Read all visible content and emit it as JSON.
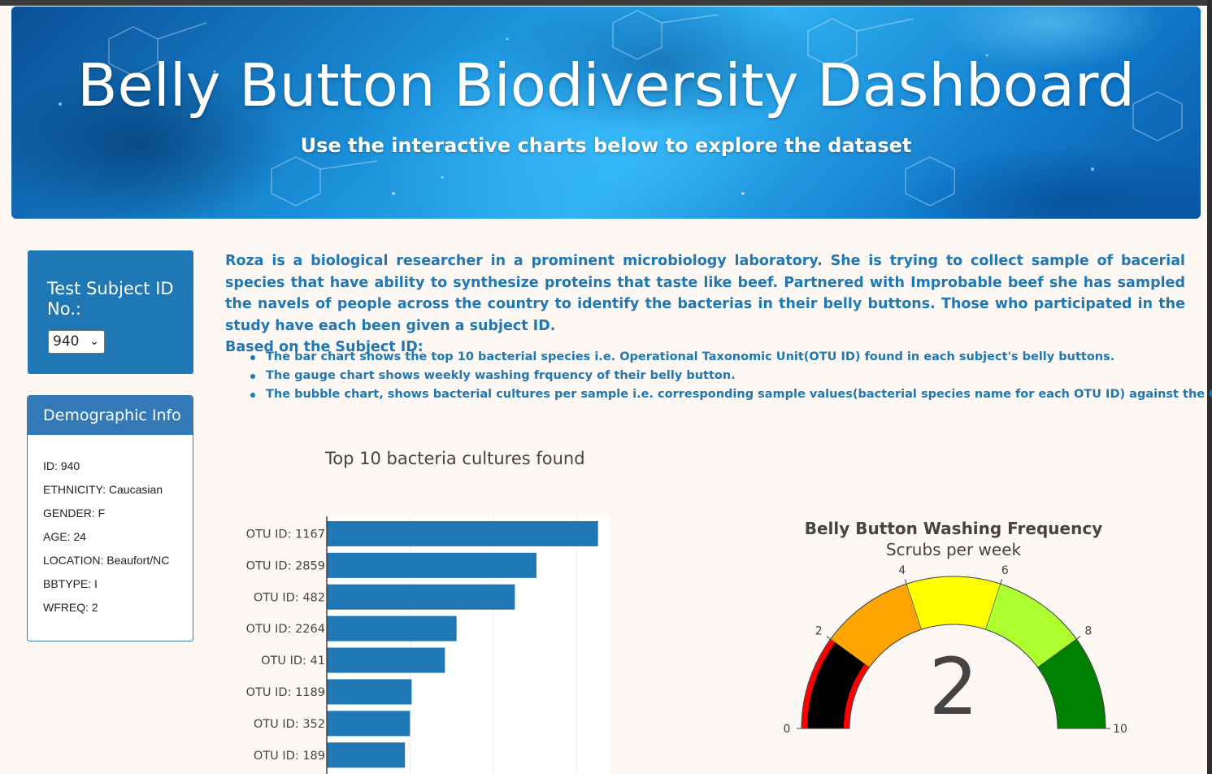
{
  "header": {
    "title": "Belly Button Biodiversity Dashboard",
    "subtitle": "Use the interactive charts below to explore the dataset"
  },
  "selector": {
    "label": "Test Subject ID No.:",
    "value": "940"
  },
  "demographics": {
    "heading": "Demographic Info",
    "rows": [
      "ID: 940",
      "ETHNICITY: Caucasian",
      "GENDER: F",
      "AGE: 24",
      "LOCATION: Beaufort/NC",
      "BBTYPE: I",
      "WFREQ: 2"
    ]
  },
  "intro": {
    "paragraph": "Roza is a biological researcher in a prominent microbiology laboratory. She is trying to collect sample of bacerial species that have ability to synthesize proteins that taste like beef. Partnered with Improbable beef she has sampled the navels of people across the country to identify the bacterias in their belly buttons. Those who participated in the study have each been given a subject ID.",
    "lead": "Based on the Subject ID:",
    "bullets": [
      "The bar chart shows the top 10 bacterial species i.e. Operational Taxonomic Unit(OTU ID) found in each subject's belly buttons.",
      "The gauge chart shows weekly washing frquency of their belly button.",
      "The bubble chart, shows bacterial cultures per sample i.e. corresponding sample values(bacterial species name for each OTU ID) against the OTU ID."
    ]
  },
  "chart_data": [
    {
      "type": "bar",
      "orientation": "horizontal",
      "title": "Top 10 bacteria cultures found",
      "categories": [
        "OTU ID: 1167",
        "OTU ID: 2859",
        "OTU ID: 482",
        "OTU ID: 2264",
        "OTU ID: 41",
        "OTU ID: 1189",
        "OTU ID: 352",
        "OTU ID: 189"
      ],
      "values": [
        163,
        126,
        113,
        78,
        71,
        51,
        50,
        47
      ],
      "grid": true,
      "color": "#1f77b4"
    },
    {
      "type": "gauge",
      "title": "Belly Button Washing Frequency",
      "subtitle": "Scrubs per week",
      "value": 2,
      "range": [
        0,
        10
      ],
      "ticks": [
        "0",
        "2",
        "4",
        "6",
        "8",
        "10"
      ],
      "steps": [
        {
          "from": 0,
          "to": 2,
          "color": "#ff0000"
        },
        {
          "from": 2,
          "to": 4,
          "color": "#ffa500"
        },
        {
          "from": 4,
          "to": 6,
          "color": "#ffff00"
        },
        {
          "from": 6,
          "to": 8,
          "color": "#adff2f"
        },
        {
          "from": 8,
          "to": 10,
          "color": "#008000"
        }
      ],
      "bar_color": "#000000"
    }
  ]
}
